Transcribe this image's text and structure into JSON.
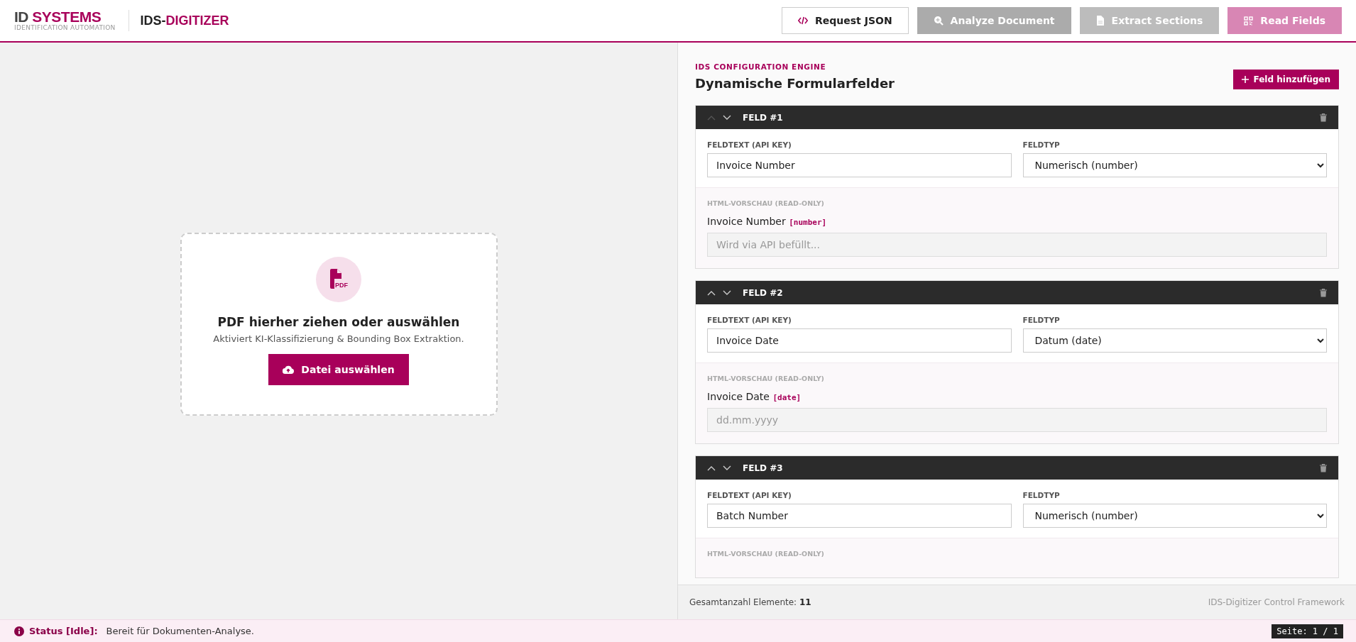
{
  "header": {
    "logo": {
      "brand_part_1": "ID",
      "brand_part_2": "SYSTEMS",
      "tagline": "IDENTIFICATION AUTOMATION"
    },
    "app_title": {
      "prefix": "IDS-",
      "accent": "DIGITIZER"
    },
    "actions": [
      {
        "label": "Request JSON",
        "kind": "code",
        "disabled": false
      },
      {
        "label": "Analyze Document",
        "kind": "search",
        "disabled": true
      },
      {
        "label": "Extract Sections",
        "kind": "file",
        "disabled": true
      },
      {
        "label": "Read Fields",
        "kind": "grid",
        "disabled": true
      }
    ]
  },
  "upload": {
    "icon_text": "PDF",
    "title": "PDF hierher ziehen oder auswählen",
    "subtitle": "Aktiviert KI-Klassifizierung & Bounding Box Extraktion.",
    "button": "Datei auswählen"
  },
  "config": {
    "eyebrow": "IDS CONFIGURATION ENGINE",
    "title": "Dynamische Formularfelder",
    "add_button": "Feld hinzufügen",
    "fields": [
      {
        "title": "FELD #1",
        "can_move_up": false,
        "key_label": "FELDTEXT (API KEY)",
        "key_value": "Invoice Number",
        "type_label": "FELDTYP",
        "type_value": "Numerisch (number)",
        "preview_heading": "HTML-VORSCHAU (READ-ONLY)",
        "preview_label": "Invoice Number",
        "preview_tag": "[number]",
        "preview_placeholder": "Wird via API befüllt..."
      },
      {
        "title": "FELD #2",
        "can_move_up": true,
        "key_label": "FELDTEXT (API KEY)",
        "key_value": "Invoice Date",
        "type_label": "FELDTYP",
        "type_value": "Datum (date)",
        "preview_heading": "HTML-VORSCHAU (READ-ONLY)",
        "preview_label": "Invoice Date",
        "preview_tag": "[date]",
        "preview_placeholder": "dd.mm.yyyy"
      },
      {
        "title": "FELD #3",
        "can_move_up": true,
        "key_label": "FELDTEXT (API KEY)",
        "key_value": "Batch Number",
        "type_label": "FELDTYP",
        "type_value": "Numerisch (number)",
        "preview_heading": "HTML-VORSCHAU (READ-ONLY)"
      }
    ],
    "footer": {
      "count_label": "Gesamtanzahl Elemente:",
      "count_value": "11",
      "framework": "IDS-Digitizer Control Framework"
    }
  },
  "status_bar": {
    "label": "Status [Idle]:",
    "message": "Bereit für Dokumenten-Analyse.",
    "page": "Seite: 1 / 1"
  }
}
